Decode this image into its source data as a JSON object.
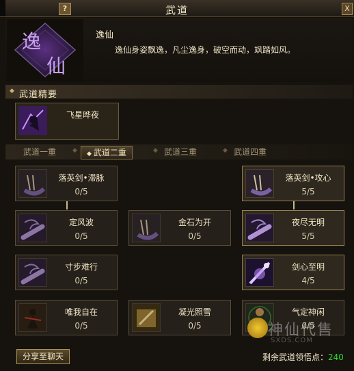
{
  "window": {
    "title": "武道",
    "help_label": "?",
    "close_label": "X"
  },
  "skill": {
    "emblem_text": "逸仙",
    "name": "逸仙",
    "description": "逸仙身姿飘逸，凡尘逸身，破空而动，飒踏如风。"
  },
  "section": {
    "title": "武道精要"
  },
  "featured": {
    "name": "飞星晔夜",
    "icon": "purple-ninja-icon"
  },
  "tabs": [
    {
      "label": "武道一重",
      "active": false
    },
    {
      "label": "武道二重",
      "active": true
    },
    {
      "label": "武道三重",
      "active": false
    },
    {
      "label": "武道四重",
      "active": false
    }
  ],
  "nodes": [
    {
      "name": "落英剑•滞脉",
      "points": "0/5",
      "icon": "blade-rune-icon",
      "on": false
    },
    {
      "name": "落英剑•攻心",
      "points": "5/5",
      "icon": "blade-rune-icon",
      "on": true
    },
    {
      "name": "定风波",
      "points": "0/5",
      "icon": "purple-swirl-blade-icon",
      "on": false
    },
    {
      "name": "金石为开",
      "points": "0/5",
      "icon": "blade-rune-icon",
      "on": false
    },
    {
      "name": "夜尽无明",
      "points": "5/5",
      "icon": "purple-swirl-blade-icon",
      "on": true
    },
    {
      "name": "寸步难行",
      "points": "0/5",
      "icon": "purple-swirl-blade-icon",
      "on": false
    },
    {
      "name": "剑心至明",
      "points": "4/5",
      "icon": "purple-flare-icon",
      "on": true
    },
    {
      "name": "唯我自在",
      "points": "0/5",
      "icon": "warrior-figure-icon",
      "on": false
    },
    {
      "name": "凝光照雪",
      "points": "0/5",
      "icon": "golden-glow-icon",
      "on": false
    },
    {
      "name": "气定神闲",
      "points": "0/5",
      "icon": "meditating-monk-icon",
      "on": false
    }
  ],
  "footer": {
    "share_label": "分享至聊天",
    "points_label": "剩余武道领悟点：",
    "points_value": "240"
  },
  "watermark": {
    "text": "神仙代售",
    "sub": "SXDS.COM"
  },
  "colors": {
    "accent": "#b09050",
    "points_value": "#30d830",
    "emblem_purple": "#7a3fb0"
  }
}
